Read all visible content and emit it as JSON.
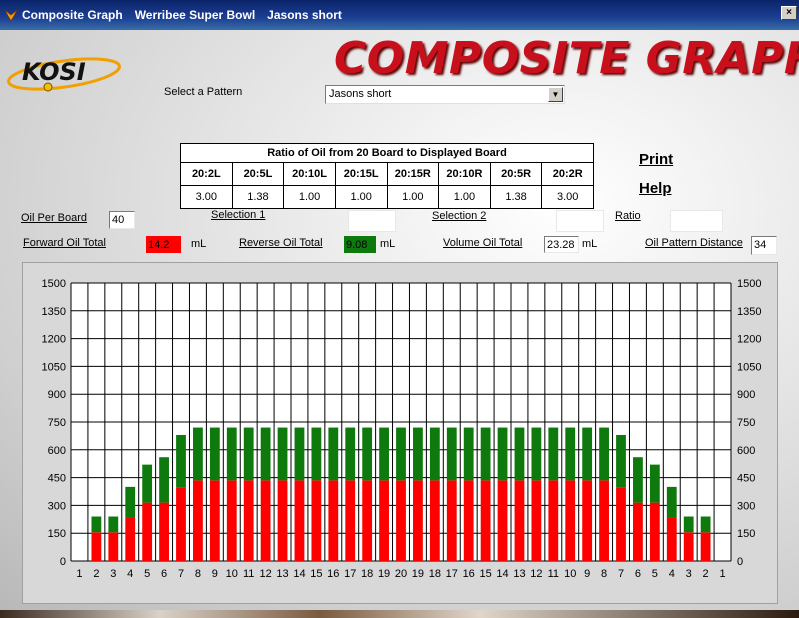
{
  "window": {
    "title_parts": [
      "Composite Graph",
      "Werribee Super Bowl",
      "Jasons short"
    ],
    "close_label": "×"
  },
  "header": {
    "logo_text": "KOSI",
    "banner_text": "COMPOSITE GRAPH"
  },
  "pattern": {
    "label": "Select a Pattern",
    "selected": "Jasons short"
  },
  "ratio_table": {
    "title": "Ratio of Oil from 20 Board to Displayed Board",
    "headers": [
      "20:2L",
      "20:5L",
      "20:10L",
      "20:15L",
      "20:15R",
      "20:10R",
      "20:5R",
      "20:2R"
    ],
    "values": [
      "3.00",
      "1.38",
      "1.00",
      "1.00",
      "1.00",
      "1.00",
      "1.38",
      "3.00"
    ]
  },
  "links": {
    "print": "Print",
    "help": "Help"
  },
  "controls": {
    "oil_per_board_label": "Oil Per Board",
    "oil_per_board_value": "40",
    "selection1_label": "Selection 1",
    "selection1_value": "",
    "selection2_label": "Selection 2",
    "selection2_value": "",
    "ratio_label": "Ratio",
    "ratio_value": "",
    "forward_label": "Forward Oil Total",
    "forward_value": "14.2",
    "forward_unit": "mL",
    "reverse_label": "Reverse Oil Total",
    "reverse_value": "9.08",
    "reverse_unit": "mL",
    "volume_label": "Volume Oil Total",
    "volume_value": "23.28",
    "volume_unit": "mL",
    "distance_label": "Oil Pattern Distance",
    "distance_value": "34"
  },
  "colors": {
    "forward": "#ff0000",
    "reverse": "#0e7a0e",
    "banner": "#c8101c",
    "titlebar": "#0a246a"
  },
  "chart_data": {
    "type": "bar",
    "stacked": true,
    "categories": [
      "1",
      "2",
      "3",
      "4",
      "5",
      "6",
      "7",
      "8",
      "9",
      "10",
      "11",
      "12",
      "13",
      "14",
      "15",
      "16",
      "17",
      "18",
      "19",
      "20",
      "19",
      "18",
      "17",
      "16",
      "15",
      "14",
      "13",
      "12",
      "11",
      "10",
      "9",
      "8",
      "7",
      "6",
      "5",
      "4",
      "3",
      "2",
      "1"
    ],
    "series": [
      {
        "name": "Forward",
        "color": "#ff0000",
        "values": [
          0,
          155,
          155,
          235,
          315,
          315,
          395,
          435,
          435,
          435,
          435,
          435,
          435,
          435,
          435,
          435,
          435,
          435,
          435,
          435,
          435,
          435,
          435,
          435,
          435,
          435,
          435,
          435,
          435,
          435,
          435,
          435,
          395,
          315,
          315,
          235,
          155,
          155,
          0
        ]
      },
      {
        "name": "Reverse",
        "color": "#0e7a0e",
        "values": [
          0,
          85,
          85,
          165,
          205,
          245,
          285,
          285,
          285,
          285,
          285,
          285,
          285,
          285,
          285,
          285,
          285,
          285,
          285,
          285,
          285,
          285,
          285,
          285,
          285,
          285,
          285,
          285,
          285,
          285,
          285,
          285,
          285,
          245,
          205,
          165,
          85,
          85,
          0
        ]
      }
    ],
    "yticks": [
      "0",
      "150",
      "300",
      "450",
      "600",
      "750",
      "900",
      "1050",
      "1200",
      "1350",
      "1500"
    ],
    "ylim": [
      0,
      1500
    ],
    "grid": true
  }
}
